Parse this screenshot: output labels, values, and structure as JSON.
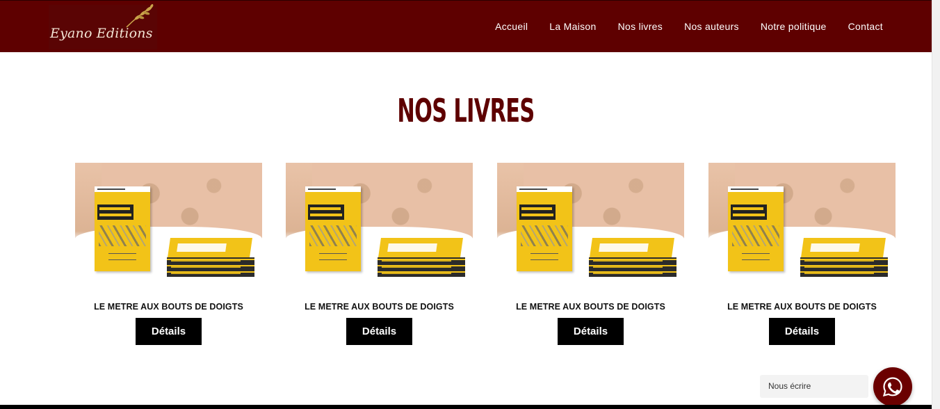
{
  "brand": {
    "name": "Eyano Editions"
  },
  "nav": {
    "items": [
      {
        "label": "Accueil"
      },
      {
        "label": "La Maison"
      },
      {
        "label": "Nos livres"
      },
      {
        "label": "Nos auteurs"
      },
      {
        "label": "Notre politique"
      },
      {
        "label": "Contact"
      }
    ]
  },
  "section": {
    "title": "NOS LIVRES"
  },
  "books": [
    {
      "title": "LE METRE AUX BOUTS DE DOIGTS",
      "button_label": "Détails"
    },
    {
      "title": "LE METRE AUX BOUTS DE DOIGTS",
      "button_label": "Détails"
    },
    {
      "title": "LE METRE AUX BOUTS DE DOIGTS",
      "button_label": "Détails"
    },
    {
      "title": "LE METRE AUX BOUTS DE DOIGTS",
      "button_label": "Détails"
    }
  ],
  "chat": {
    "label": "Nous écrire",
    "icon": "whatsapp-icon"
  },
  "colors": {
    "brand_primary": "#5e0000",
    "button": "#000000",
    "chat_button": "#6b0000"
  }
}
